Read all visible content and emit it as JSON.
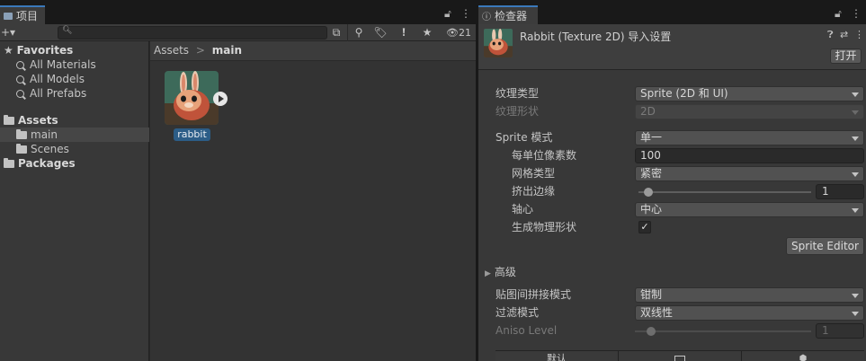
{
  "project_window": {
    "tab_label": "项目",
    "search": {
      "value": "",
      "placeholder": ""
    },
    "hidden_count": "21",
    "favorites": {
      "title": "Favorites",
      "items": [
        "All Materials",
        "All Models",
        "All Prefabs"
      ]
    },
    "tree": {
      "assets": "Assets",
      "children": [
        "main",
        "Scenes"
      ],
      "packages": "Packages"
    },
    "breadcrumb": {
      "root": "Assets",
      "separator": ">",
      "current": "main"
    },
    "asset": {
      "name": "rabbit"
    }
  },
  "inspector": {
    "tab_label": "检查器",
    "title": "Rabbit (Texture 2D) 导入设置",
    "open_button": "打开",
    "props": {
      "texture_type": {
        "label": "纹理类型",
        "value": "Sprite (2D 和 UI)"
      },
      "texture_shape": {
        "label": "纹理形状",
        "value": "2D"
      },
      "sprite_mode": {
        "label": "Sprite 模式",
        "value": "单一"
      },
      "pixels_per_unit": {
        "label": "每单位像素数",
        "value": "100"
      },
      "mesh_type": {
        "label": "网格类型",
        "value": "紧密"
      },
      "extrude_edges": {
        "label": "挤出边缘",
        "value": "1"
      },
      "pivot": {
        "label": "轴心",
        "value": "中心"
      },
      "generate_physics_shape": {
        "label": "生成物理形状",
        "checked": "✓"
      },
      "advanced": {
        "label": "高级"
      },
      "wrap_mode": {
        "label": "贴图间拼接模式",
        "value": "钳制"
      },
      "filter_mode": {
        "label": "过滤模式",
        "value": "双线性"
      },
      "aniso_level": {
        "label": "Aniso Level",
        "value": "1"
      }
    },
    "sprite_editor_button": "Sprite Editor",
    "platform_tabs": [
      "默认"
    ]
  },
  "colors": {
    "accent": "#3a79bb",
    "selection_label": "#2c5d87",
    "panel": "#383838"
  }
}
